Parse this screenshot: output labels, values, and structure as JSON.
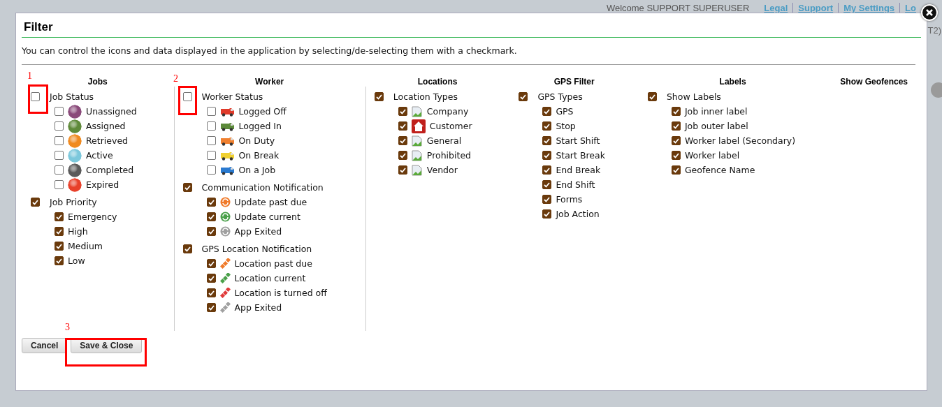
{
  "app": {
    "welcome": "Welcome SUPPORT SUPERUSER",
    "links": [
      "Legal",
      "Support",
      "My Settings",
      "Lo"
    ],
    "right_fragment": "T2)"
  },
  "dialog": {
    "title": "Filter",
    "description": "You can control the icons and data displayed in the application by selecting/de-selecting them with a checkmark.",
    "columns": [
      {
        "title": "Jobs",
        "groups": [
          {
            "label": "Job Status",
            "checked": false,
            "items": [
              {
                "label": "Unassigned",
                "checked": false,
                "kind": "ball",
                "color": "#8a4a7a"
              },
              {
                "label": "Assigned",
                "checked": false,
                "kind": "ball",
                "color": "#5f8a3a"
              },
              {
                "label": "Retrieved",
                "checked": false,
                "kind": "ball",
                "color": "#f08a20"
              },
              {
                "label": "Active",
                "checked": false,
                "kind": "ball",
                "color": "#7cc8dc"
              },
              {
                "label": "Completed",
                "checked": false,
                "kind": "ball",
                "color": "#5a5a5a"
              },
              {
                "label": "Expired",
                "checked": false,
                "kind": "ball",
                "color": "#e8402a"
              }
            ]
          },
          {
            "label": "Job Priority",
            "checked": true,
            "items": [
              {
                "label": "Emergency",
                "checked": true
              },
              {
                "label": "High",
                "checked": true
              },
              {
                "label": "Medium",
                "checked": true
              },
              {
                "label": "Low",
                "checked": true
              }
            ]
          }
        ]
      },
      {
        "title": "Worker",
        "groups": [
          {
            "label": "Worker Status",
            "checked": false,
            "items": [
              {
                "label": "Logged Off",
                "checked": false,
                "kind": "van",
                "color": "#e03a2a"
              },
              {
                "label": "Logged In",
                "checked": false,
                "kind": "van",
                "color": "#5c8a3a"
              },
              {
                "label": "On Duty",
                "checked": false,
                "kind": "van",
                "color": "#f08030"
              },
              {
                "label": "On Break",
                "checked": false,
                "kind": "van",
                "color": "#f0d030"
              },
              {
                "label": "On a Job",
                "checked": false,
                "kind": "van",
                "color": "#2a7ad0"
              }
            ]
          },
          {
            "label": "Communication Notification",
            "checked": true,
            "items": [
              {
                "label": "Update past due",
                "checked": true,
                "kind": "sync",
                "color": "#f07a2a"
              },
              {
                "label": "Update current",
                "checked": true,
                "kind": "sync",
                "color": "#4aa04a"
              },
              {
                "label": "App Exited",
                "checked": true,
                "kind": "sync",
                "color": "#a0a0a0"
              }
            ]
          },
          {
            "label": "GPS Location Notification",
            "checked": true,
            "items": [
              {
                "label": "Location past due",
                "checked": true,
                "kind": "satellite",
                "color": "#f07a2a"
              },
              {
                "label": "Location current",
                "checked": true,
                "kind": "satellite",
                "color": "#4aa04a"
              },
              {
                "label": "Location is turned off",
                "checked": true,
                "kind": "satellite",
                "color": "#e03a3a"
              },
              {
                "label": "App Exited",
                "checked": true,
                "kind": "satellite",
                "color": "#a0a0a0"
              }
            ]
          }
        ]
      },
      {
        "title": "Locations",
        "groups": [
          {
            "label": "Location Types",
            "checked": true,
            "items": [
              {
                "label": "Company",
                "checked": true,
                "kind": "broken-image"
              },
              {
                "label": "Customer",
                "checked": true,
                "kind": "house"
              },
              {
                "label": "General",
                "checked": true,
                "kind": "broken-image"
              },
              {
                "label": "Prohibited",
                "checked": true,
                "kind": "broken-image"
              },
              {
                "label": "Vendor",
                "checked": true,
                "kind": "broken-image"
              }
            ]
          }
        ]
      },
      {
        "title": "GPS Filter",
        "groups": [
          {
            "label": "GPS Types",
            "checked": true,
            "items": [
              {
                "label": "GPS",
                "checked": true
              },
              {
                "label": "Stop",
                "checked": true
              },
              {
                "label": "Start Shift",
                "checked": true
              },
              {
                "label": "Start Break",
                "checked": true
              },
              {
                "label": "End Break",
                "checked": true
              },
              {
                "label": "End Shift",
                "checked": true
              },
              {
                "label": "Forms",
                "checked": true
              },
              {
                "label": "Job Action",
                "checked": true
              }
            ]
          }
        ]
      },
      {
        "title": "Labels",
        "groups": [
          {
            "label": "Show Labels",
            "checked": true,
            "items": [
              {
                "label": "Job inner label",
                "checked": true
              },
              {
                "label": "Job outer label",
                "checked": true
              },
              {
                "label": "Worker label (Secondary)",
                "checked": true
              },
              {
                "label": "Worker label",
                "checked": true
              },
              {
                "label": "Geofence Name",
                "checked": true
              }
            ]
          }
        ]
      },
      {
        "title": "Show Geofences"
      }
    ],
    "buttons": [
      "Cancel",
      "Save & Close"
    ],
    "annotations": [
      "1",
      "2",
      "3"
    ]
  }
}
